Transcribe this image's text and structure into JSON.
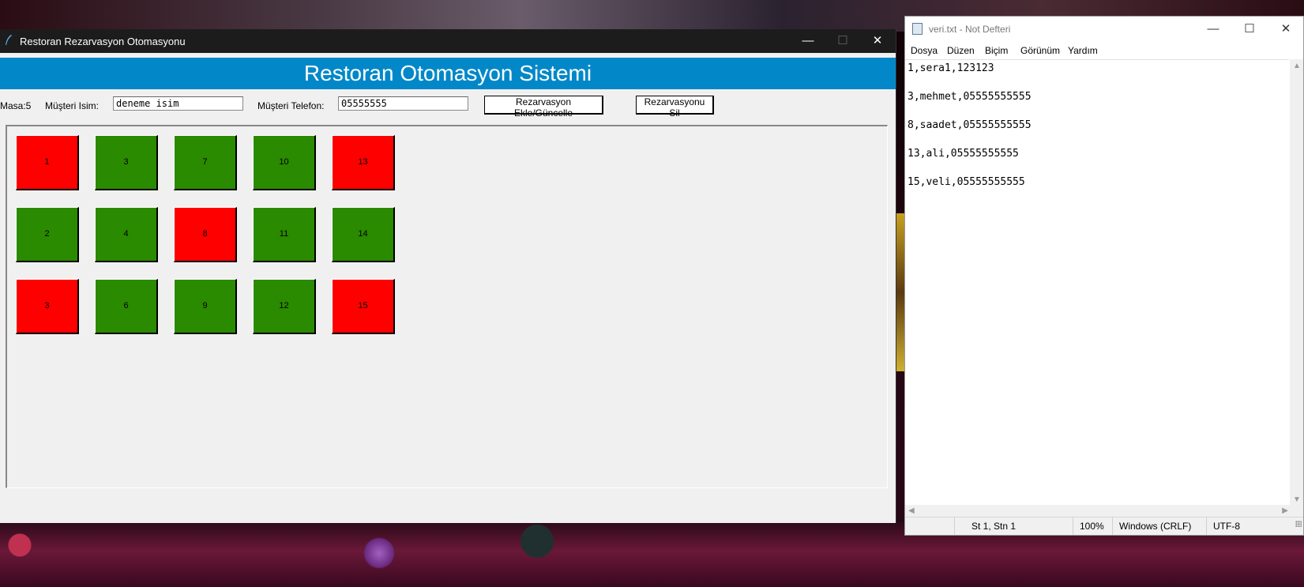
{
  "tk_window": {
    "title": "Restoran Rezarvasyon Otomasyonu",
    "controls": {
      "minimize": "—",
      "maximize": "☐",
      "close": "✕"
    },
    "banner": "Restoran Otomasyon Sistemi",
    "form": {
      "masa_label": "Masa:5",
      "name_label": "Müşteri Isim:",
      "name_value": "deneme isim",
      "phone_label": "Müşteri Telefon:",
      "phone_value": "05555555",
      "add_button": "Rezarvasyon Ekle/Güncelle",
      "delete_button": "Rezarvasyonu Sil"
    },
    "colors": {
      "reserved": "#ff0000",
      "free": "#2a8a00",
      "banner": "#0288c8"
    },
    "tables": [
      {
        "label": "1",
        "status": "reserved"
      },
      {
        "label": "3",
        "status": "free"
      },
      {
        "label": "7",
        "status": "free"
      },
      {
        "label": "10",
        "status": "free"
      },
      {
        "label": "13",
        "status": "reserved"
      },
      {
        "label": "2",
        "status": "free"
      },
      {
        "label": "4",
        "status": "free"
      },
      {
        "label": "8",
        "status": "reserved"
      },
      {
        "label": "11",
        "status": "free"
      },
      {
        "label": "14",
        "status": "free"
      },
      {
        "label": "3",
        "status": "reserved"
      },
      {
        "label": "6",
        "status": "free"
      },
      {
        "label": "9",
        "status": "free"
      },
      {
        "label": "12",
        "status": "free"
      },
      {
        "label": "15",
        "status": "reserved"
      }
    ]
  },
  "notepad": {
    "title": "veri.txt - Not Defteri",
    "controls": {
      "minimize": "—",
      "maximize": "☐",
      "close": "✕"
    },
    "menu": [
      "Dosya",
      "Düzen",
      "Biçim",
      "Görünüm",
      "Yardım"
    ],
    "lines": [
      "1,sera1,123123",
      "",
      "3,mehmet,05555555555",
      "",
      "8,saadet,05555555555",
      "",
      "13,ali,05555555555",
      "",
      "15,veli,05555555555"
    ],
    "status": {
      "position": "St 1, Stn 1",
      "zoom": "100%",
      "line_ending": "Windows (CRLF)",
      "encoding": "UTF-8"
    }
  }
}
